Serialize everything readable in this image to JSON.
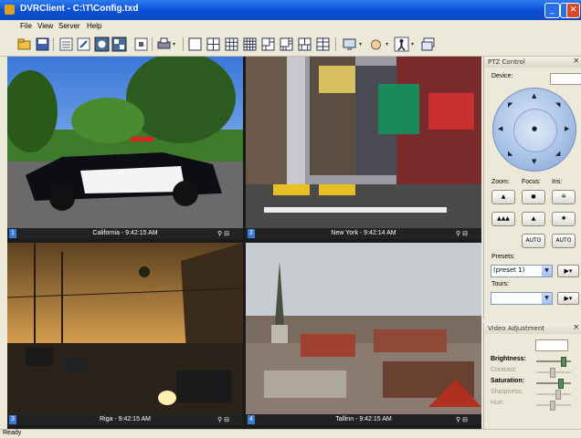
{
  "window": {
    "title": "DVRClient - C:\\T\\Config.txd",
    "minimize": "_",
    "maximize": "▫",
    "close": "✕"
  },
  "menu": [
    "File",
    "View",
    "Server",
    "Help"
  ],
  "panes": [
    {
      "num": "1",
      "label": "California - 9:42:15 AM",
      "icons": "⚲ ⊟"
    },
    {
      "num": "2",
      "label": "New York - 9:42:14 AM",
      "icons": "⚲ ⊟"
    },
    {
      "num": "3",
      "label": "Riga - 9:42:15 AM",
      "icons": "⚲ ⊟"
    },
    {
      "num": "4",
      "label": "Tallinn - 9:42:15 AM",
      "icons": "⚲ ⊟"
    }
  ],
  "ptz": {
    "title": "PTZ Control",
    "close": "×",
    "device_label": "Device:",
    "zoom_label": "Zoom:",
    "focus_label": "Focus:",
    "iris_label": "Iris:",
    "auto1": "AUTO",
    "auto2": "AUTO",
    "presets_label": "Presets:",
    "preset_value": "(preset 1)",
    "tours_label": "Tours:",
    "tour_value": ""
  },
  "video_adjustment": {
    "title": "Video Adjustment",
    "close": "×",
    "brightness": "Brightness:",
    "contrast": "Contrast:",
    "saturation": "Saturation:",
    "sharpness": "Sharpness:",
    "hue": "Hue:"
  },
  "status": "Ready"
}
